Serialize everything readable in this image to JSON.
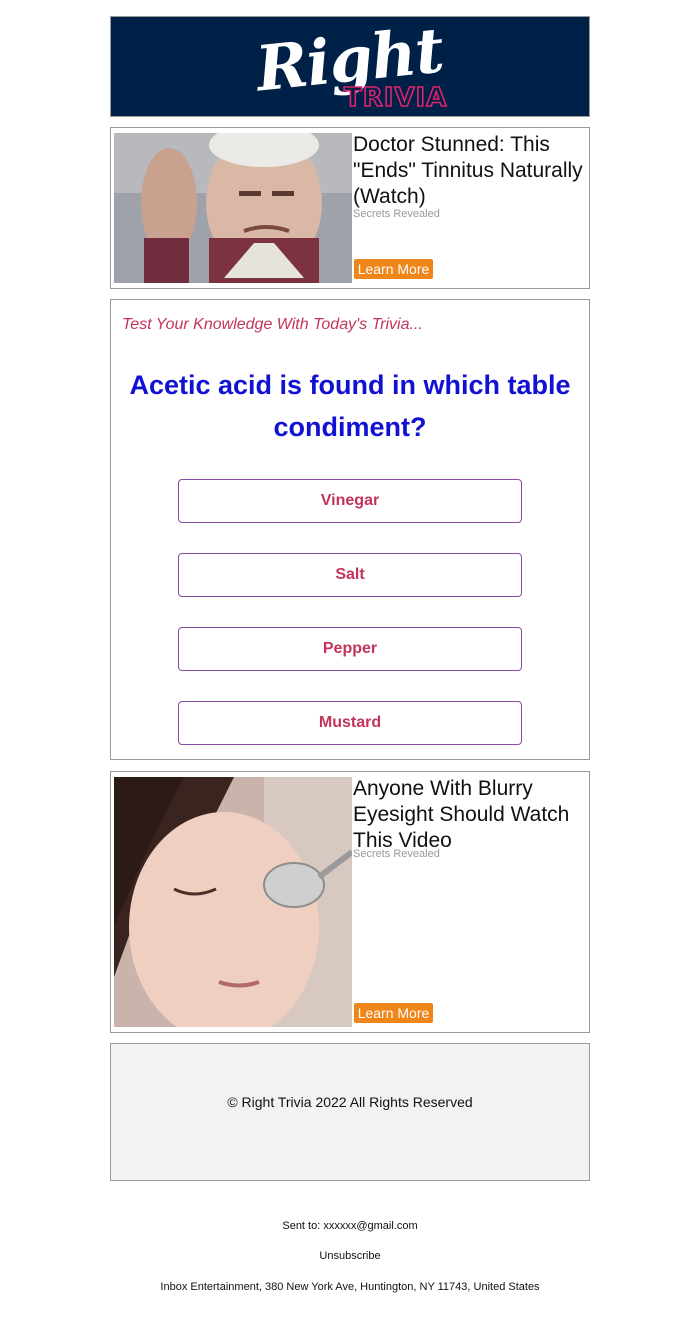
{
  "header": {
    "logo_word1": "Right",
    "logo_word2": "TRIVIA",
    "bg_color": "#002147",
    "accent_color": "#e0226e"
  },
  "ads": [
    {
      "title": "Doctor Stunned: This \"Ends\" Tinnitus Naturally (Watch)",
      "source": "Secrets Revealed",
      "button": "Learn More",
      "image": "elderly-man-holding-ear-photo"
    },
    {
      "title": "Anyone With Blurry Eyesight Should Watch This Video",
      "source": "Secrets Revealed",
      "button": "Learn More",
      "image": "woman-spoon-over-eye-photo"
    }
  ],
  "quiz": {
    "intro": "Test Your Knowledge With Today's Trivia...",
    "question": "Acetic acid is found in which table condiment?",
    "answers": [
      "Vinegar",
      "Salt",
      "Pepper",
      "Mustard"
    ]
  },
  "footer": {
    "copyright": "© Right Trivia 2022 All Rights Reserved",
    "sent_to": "Sent to: xxxxxx@gmail.com",
    "unsubscribe": "Unsubscribe",
    "address": "Inbox Entertainment, 380 New York Ave, Huntington, NY 11743, United States"
  },
  "colors": {
    "button_orange": "#f08519",
    "question_blue": "#1111d4",
    "answer_pink": "#c4345a"
  }
}
